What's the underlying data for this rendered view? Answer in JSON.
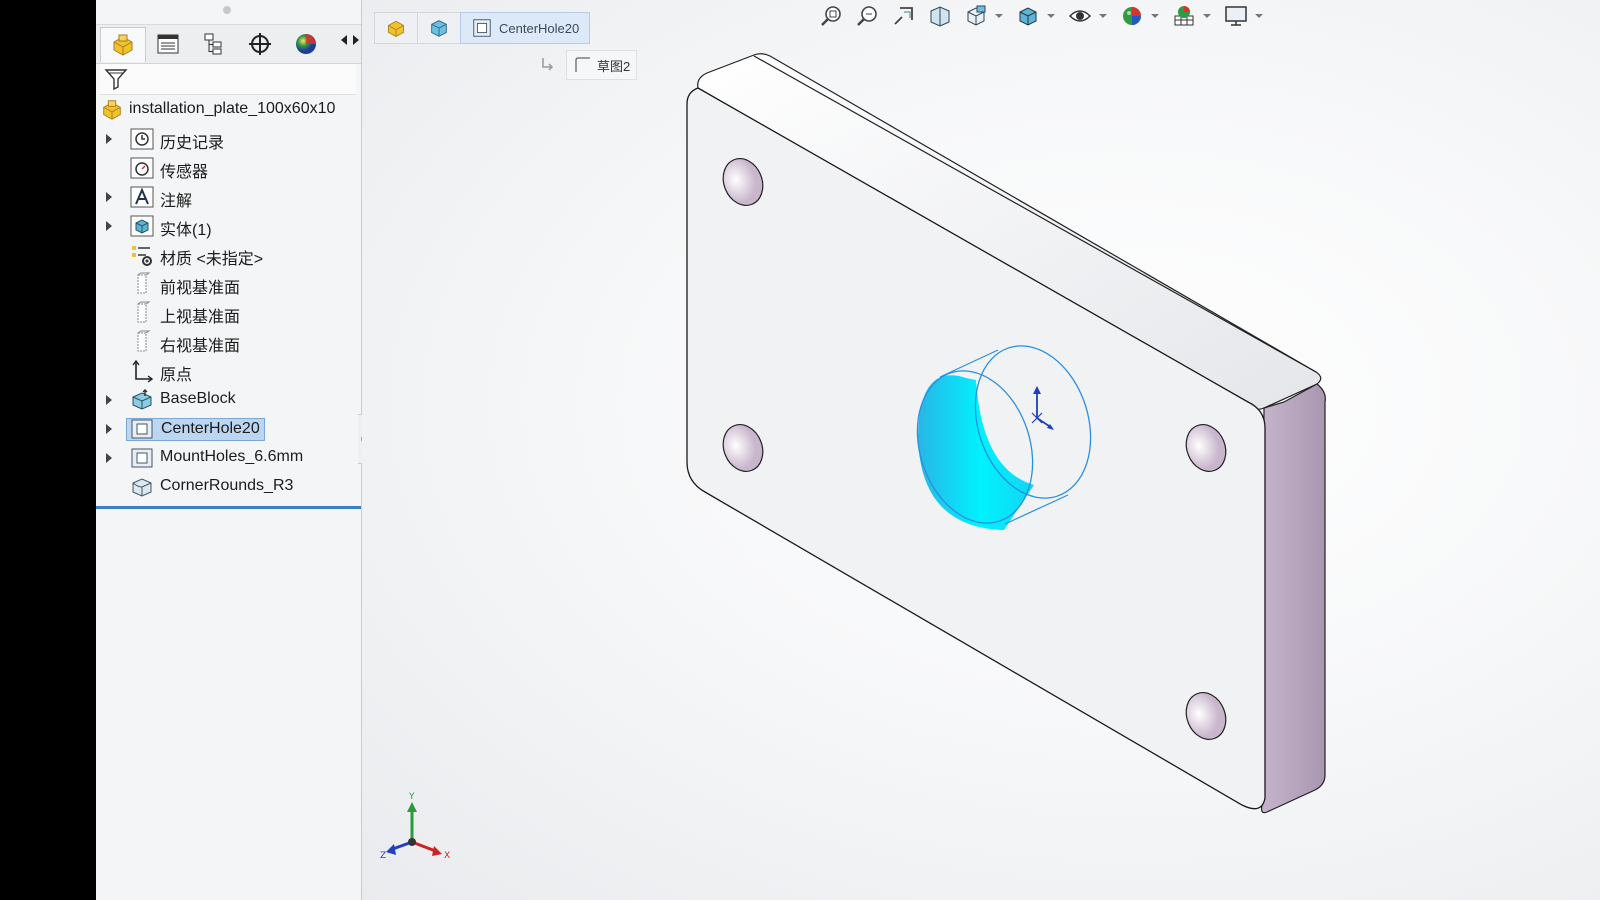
{
  "panel": {
    "tabs": [
      {
        "name": "featuremanager-tab",
        "icon": "part-icon",
        "active": true
      },
      {
        "name": "propertymanager-tab",
        "icon": "property-list-icon",
        "active": false
      },
      {
        "name": "configurationmanager-tab",
        "icon": "configuration-icon",
        "active": false
      },
      {
        "name": "dimxpert-tab",
        "icon": "crosshair-icon",
        "active": false
      },
      {
        "name": "appearance-tab",
        "icon": "appearance-sphere-icon",
        "active": false
      }
    ],
    "tree": {
      "root": "installation_plate_100x60x10",
      "items": [
        {
          "label": "历史记录",
          "icon": "history-icon",
          "expandable": true
        },
        {
          "label": "传感器",
          "icon": "sensor-icon",
          "expandable": false
        },
        {
          "label": "注解",
          "icon": "annotation-icon",
          "expandable": true
        },
        {
          "label": "实体(1)",
          "icon": "solid-body-icon",
          "expandable": true
        },
        {
          "label": "材质 <未指定>",
          "icon": "material-icon",
          "expandable": false
        },
        {
          "label": "前视基准面",
          "icon": "plane-icon",
          "expandable": false
        },
        {
          "label": "上视基准面",
          "icon": "plane-icon",
          "expandable": false
        },
        {
          "label": "右视基准面",
          "icon": "plane-icon",
          "expandable": false
        },
        {
          "label": "原点",
          "icon": "origin-icon",
          "expandable": false
        },
        {
          "label": "BaseBlock",
          "icon": "extrude-feature-icon",
          "expandable": true
        },
        {
          "label": "CenterHole20",
          "icon": "cut-feature-icon",
          "expandable": true,
          "selected": true
        },
        {
          "label": "MountHoles_6.6mm",
          "icon": "cut-feature-icon",
          "expandable": true
        },
        {
          "label": "CornerRounds_R3",
          "icon": "fillet-feature-icon",
          "expandable": false
        }
      ]
    }
  },
  "breadcrumb": {
    "items": [
      "part-icon",
      "solid-body-icon",
      "cut-feature-icon"
    ],
    "current": "CenterHole20",
    "sub": "草图2"
  },
  "view_toolbar": [
    "zoom-to-fit-icon",
    "zoom-to-area-icon",
    "previous-view-icon",
    "section-view-icon",
    "view-orientation-icon",
    "display-style-icon",
    "hide-show-items-icon",
    "edit-appearance-icon",
    "apply-scene-icon",
    "view-settings-icon"
  ],
  "triad": {
    "x": "X",
    "y": "Y",
    "z": "Z"
  },
  "colors": {
    "selection_blue": "#3d7fc1",
    "hole_highlight": "#00e5ff",
    "side_face": "#b8a4bf",
    "tree_selected_bg": "#bcd6f1"
  }
}
